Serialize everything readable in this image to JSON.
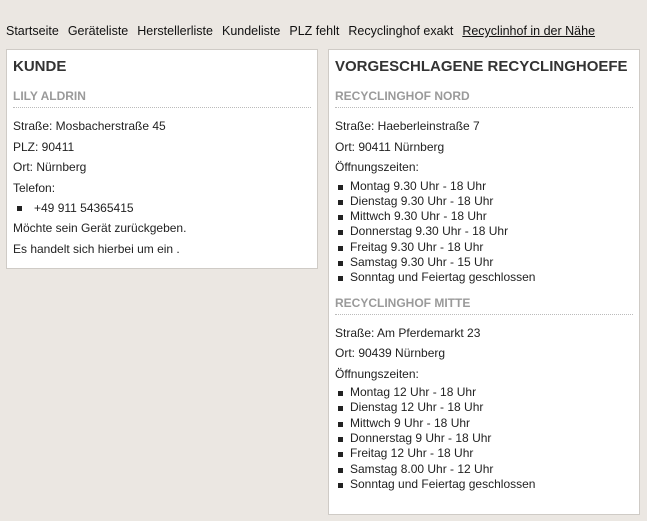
{
  "nav": [
    "Startseite",
    "Geräteliste",
    "Herstellerliste",
    "Kundeliste",
    "PLZ fehlt",
    "Recyclinghof exakt",
    "Recyclinhof in der Nähe"
  ],
  "kunde": {
    "title": "KUNDE",
    "name": "LILY ALDRIN",
    "strasse": "Straße: Mosbacherstraße 45",
    "plz": "PLZ: 90411",
    "ort": "Ort: Nürnberg",
    "telefon_label": "Telefon:",
    "telefon": "+49 911 54365415",
    "note1": "Möchte sein Gerät zurückgeben.",
    "note2": "Es handelt sich hierbei um ein ."
  },
  "recycling": {
    "title": "VORGESCHLAGENE RECYCLINGHOEFE",
    "hoefe": [
      {
        "name": "RECYCLINGHOF NORD",
        "strasse": "Straße: Haeberleinstraße 7",
        "ort": "Ort: 90411 Nürnberg",
        "label": "Öffnungszeiten:",
        "zeiten": [
          "Montag 9.30 Uhr - 18 Uhr",
          "Dienstag 9.30 Uhr - 18 Uhr",
          "Mittwch 9.30 Uhr - 18 Uhr",
          "Donnerstag 9.30 Uhr - 18 Uhr",
          "Freitag 9.30 Uhr - 18 Uhr",
          "Samstag 9.30 Uhr - 15 Uhr",
          "Sonntag und Feiertag geschlossen"
        ]
      },
      {
        "name": "RECYCLINGHOF MITTE",
        "strasse": "Straße: Am Pferdemarkt 23",
        "ort": "Ort: 90439 Nürnberg",
        "label": "Öffnungszeiten:",
        "zeiten": [
          "Montag 12 Uhr - 18 Uhr",
          "Dienstag 12 Uhr - 18 Uhr",
          "Mittwch 9 Uhr - 18 Uhr",
          "Donnerstag 9 Uhr - 18 Uhr",
          "Freitag 12 Uhr - 18 Uhr",
          "Samstag 8.00 Uhr - 12 Uhr",
          "Sonntag und Feiertag geschlossen"
        ]
      }
    ]
  }
}
